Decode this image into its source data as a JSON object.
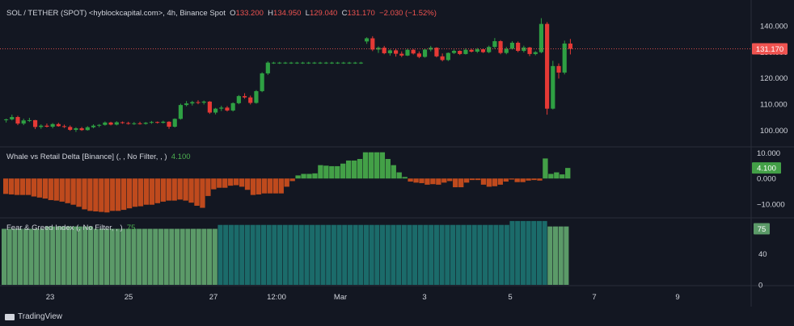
{
  "header": {
    "symbol": "SOL / TETHER (SPOT) <hyblockcapital.com>, 4h, Binance Spot",
    "o_label": "O",
    "o_value": "133.200",
    "h_label": "H",
    "h_value": "134.950",
    "l_label": "L",
    "l_value": "129.040",
    "c_label": "C",
    "c_value": "131.170",
    "change": "−2.030 (−1.52%)"
  },
  "indicators": {
    "delta_label": "Whale vs Retail Delta [Binance] (, , No Filter, , )",
    "delta_value": "4.100",
    "fg_label": "Fear & Greed Index (, No Filter, , )",
    "fg_value": "75"
  },
  "price_badge": "131.170",
  "delta_badge": "4.100",
  "fg_badge": "75",
  "footer": {
    "brand": "TradingView"
  },
  "colors": {
    "up": "#26a69a",
    "down": "#ef5350",
    "delta_pos": "#43a047",
    "delta_neg": "#bf4a1d",
    "fg_greed": "#1b6b6a",
    "fg_light": "#5b9a68"
  },
  "chart_data": [
    {
      "type": "candlestick",
      "title": "SOL / TETHER (SPOT), 4h",
      "ylim": [
        94,
        148
      ],
      "y_ticks": [
        "140.000",
        "130.000",
        "120.000",
        "110.000",
        "100.000"
      ],
      "x_ticks": [
        "23",
        "25",
        "27",
        "12:00",
        "Mar",
        "3",
        "5",
        "7",
        "9"
      ],
      "candles": [
        [
          104,
          104.5,
          103,
          104.2
        ],
        [
          104.2,
          106,
          103.8,
          105.1
        ],
        [
          105.1,
          105.6,
          102,
          102.6
        ],
        [
          102.6,
          104.5,
          102,
          103.8
        ],
        [
          103.8,
          104.8,
          103.2,
          103.9
        ],
        [
          103.9,
          104,
          100.5,
          101.3
        ],
        [
          101.3,
          102.3,
          100.6,
          101.8
        ],
        [
          101.8,
          102.6,
          101.1,
          101.4
        ],
        [
          101.4,
          102.8,
          100.8,
          102.4
        ],
        [
          102.4,
          102.9,
          101.4,
          101.6
        ],
        [
          101.6,
          102.2,
          100.9,
          101.3
        ],
        [
          101.3,
          101.9,
          99.8,
          100.2
        ],
        [
          100.2,
          101.2,
          99.4,
          100.8
        ],
        [
          100.8,
          101.3,
          99.8,
          100.1
        ],
        [
          100.1,
          101.6,
          99.9,
          101.2
        ],
        [
          101.2,
          102.3,
          100.8,
          101.8
        ],
        [
          101.8,
          102.4,
          101.2,
          102.1
        ],
        [
          102.1,
          103.4,
          101.8,
          103
        ],
        [
          103,
          103.3,
          101.9,
          102.2
        ],
        [
          102.2,
          103.5,
          101.9,
          103.1
        ],
        [
          103.1,
          103.4,
          102.5,
          102.8
        ],
        [
          102.8,
          103.3,
          102.2,
          102.6
        ],
        [
          102.6,
          103.2,
          102.1,
          102.7
        ],
        [
          102.7,
          103.3,
          102.2,
          102.5
        ],
        [
          102.5,
          103.2,
          102.2,
          102.9
        ],
        [
          102.9,
          103.6,
          102.5,
          103.2
        ],
        [
          103.2,
          103.4,
          102.6,
          102.9
        ],
        [
          102.9,
          103.7,
          102.6,
          103.3
        ],
        [
          103.3,
          103.5,
          100.6,
          101.4
        ],
        [
          101.4,
          104.6,
          101.1,
          104.4
        ],
        [
          104.4,
          110.2,
          104.1,
          109.7
        ],
        [
          109.7,
          111.2,
          109.2,
          110.3
        ],
        [
          110.3,
          111.3,
          109.5,
          110.8
        ],
        [
          110.8,
          111.5,
          110,
          110.6
        ],
        [
          110.6,
          111.4,
          109.9,
          111
        ],
        [
          111,
          111.2,
          106.3,
          106.8
        ],
        [
          106.8,
          108.6,
          106.1,
          108.3
        ],
        [
          108.3,
          109.4,
          107.4,
          108.7
        ],
        [
          108.7,
          109.3,
          107.2,
          107.6
        ],
        [
          107.6,
          110.7,
          107.2,
          110.4
        ],
        [
          110.4,
          113.5,
          110,
          113.1
        ],
        [
          113.1,
          114.2,
          112.1,
          112.6
        ],
        [
          112.6,
          113.3,
          109.9,
          110.5
        ],
        [
          110.5,
          115.4,
          110.2,
          115
        ],
        [
          115,
          122.2,
          114.6,
          121.8
        ],
        [
          121.8,
          126.4,
          121.2,
          125.9
        ],
        [
          125.9,
          126.2,
          125.4,
          125.9
        ],
        [
          125.9,
          126.2,
          125.4,
          125.9
        ],
        [
          125.9,
          126.2,
          125.4,
          125.9
        ],
        [
          125.9,
          126.2,
          125.4,
          125.9
        ],
        [
          125.9,
          126.2,
          125.4,
          125.9
        ],
        [
          125.9,
          126.2,
          125.4,
          125.9
        ],
        [
          125.9,
          126.2,
          125.4,
          125.9
        ],
        [
          125.9,
          126.2,
          125.4,
          125.9
        ],
        [
          125.9,
          126.2,
          125.4,
          125.9
        ],
        [
          125.9,
          126.2,
          125.4,
          125.9
        ],
        [
          125.9,
          126.2,
          125.4,
          125.9
        ],
        [
          125.9,
          126.2,
          125.4,
          125.9
        ],
        [
          125.9,
          126.2,
          125.4,
          125.9
        ],
        [
          125.9,
          126.2,
          125.4,
          125.9
        ],
        [
          125.9,
          126.2,
          125.4,
          125.9
        ],
        [
          125.9,
          126.2,
          125.4,
          125.9
        ],
        [
          134,
          135.6,
          133.1,
          135.2
        ],
        [
          135.2,
          136,
          130.3,
          130.9
        ],
        [
          130.9,
          132.1,
          129.6,
          131.6
        ],
        [
          131.6,
          132.3,
          129.1,
          129.5
        ],
        [
          129.5,
          131,
          128.6,
          130.6
        ],
        [
          130.6,
          131.2,
          128.2,
          129.3
        ],
        [
          129.3,
          130.2,
          128,
          128.6
        ],
        [
          128.6,
          131.2,
          128.4,
          130.8
        ],
        [
          130.8,
          131.1,
          129,
          129.4
        ],
        [
          129.4,
          130.2,
          127.6,
          128.1
        ],
        [
          128.1,
          131.3,
          127.8,
          130.9
        ],
        [
          130.9,
          132.3,
          130.2,
          131.6
        ],
        [
          131.6,
          131.8,
          127.9,
          128.3
        ],
        [
          128.3,
          129.4,
          126.4,
          126.9
        ],
        [
          126.9,
          129.8,
          126.5,
          129.6
        ],
        [
          129.6,
          130.9,
          129.2,
          130.4
        ],
        [
          130.4,
          130.6,
          128.8,
          129.2
        ],
        [
          129.2,
          131.4,
          129,
          130.8
        ],
        [
          130.8,
          131.2,
          129.8,
          130.1
        ],
        [
          130.1,
          131.5,
          129.6,
          131
        ],
        [
          131,
          131.3,
          129.6,
          129.9
        ],
        [
          129.9,
          132.4,
          129.5,
          131.9
        ],
        [
          131.9,
          135.3,
          131.2,
          134.1
        ],
        [
          134.1,
          134.5,
          129.1,
          129.6
        ],
        [
          129.6,
          131.9,
          129.1,
          131.2
        ],
        [
          131.2,
          134.1,
          130.9,
          133.5
        ],
        [
          133.5,
          134,
          129.9,
          130.4
        ],
        [
          130.4,
          132.4,
          129.8,
          131.7
        ],
        [
          131.7,
          131.9,
          128.4,
          129.2
        ],
        [
          129.2,
          130.3,
          128.7,
          129.9
        ],
        [
          129.9,
          142.9,
          129.5,
          140.7
        ],
        [
          140.7,
          141.4,
          106,
          108.3
        ],
        [
          108.3,
          126.6,
          108,
          124.6
        ],
        [
          124.6,
          125.6,
          119.8,
          122.1
        ],
        [
          122.1,
          134.3,
          121.4,
          133.2
        ],
        [
          133.2,
          134.95,
          129.04,
          131.17
        ]
      ],
      "last_price": 131.17,
      "last_label": "131.170"
    },
    {
      "type": "bar",
      "title": "Whale vs Retail Delta [Binance]",
      "ylim": [
        -15,
        12
      ],
      "y_ticks": [
        "10.000",
        "0.000",
        "−10.000"
      ],
      "values": [
        -6,
        -6.2,
        -6.4,
        -6.4,
        -6.4,
        -7,
        -7.4,
        -7.8,
        -8.4,
        -8.6,
        -9,
        -9.6,
        -10.2,
        -11,
        -12,
        -12.6,
        -12.8,
        -13,
        -13.2,
        -12.6,
        -12.6,
        -12.2,
        -11.6,
        -11,
        -10.8,
        -10.2,
        -10.2,
        -9.6,
        -9,
        -8.6,
        -8.6,
        -8.2,
        -8.6,
        -9.4,
        -10.6,
        -11.4,
        -6.8,
        -4.2,
        -3.6,
        -3.6,
        -2.8,
        -2.6,
        -3.2,
        -4.4,
        -6.4,
        -6.2,
        -5.8,
        -5.8,
        -5.8,
        -5.8,
        -3.2,
        -1,
        1.2,
        1.8,
        1.8,
        2,
        5.2,
        5,
        4.8,
        4.8,
        5.8,
        7,
        7,
        7.6,
        10.2,
        10.2,
        10.2,
        10.2,
        7.6,
        5.2,
        2.4,
        0.6,
        -1.2,
        -1.6,
        -1.8,
        -2.4,
        -2.2,
        -2.4,
        -1.6,
        -1,
        -3.4,
        -3.4,
        -1.6,
        -0.6,
        -0.6,
        -2.4,
        -3.2,
        -3,
        -2.4,
        -1.2,
        -0.4,
        -1.4,
        -1.4,
        -0.8,
        -0.6,
        -0.8,
        7.8,
        1.8,
        2.4,
        1.6,
        4.1
      ],
      "last_label": "4.100"
    },
    {
      "type": "bar",
      "title": "Fear & Greed Index",
      "ylim": [
        0,
        85
      ],
      "y_ticks": [
        "75",
        "40",
        "0"
      ],
      "values": [
        72,
        72,
        72,
        72,
        72,
        72,
        72,
        72,
        75,
        75,
        75,
        75,
        75,
        75,
        75,
        75,
        75,
        72,
        72,
        72,
        72,
        72,
        72,
        72,
        72,
        72,
        72,
        72,
        72,
        72,
        72,
        72,
        72,
        72,
        72,
        72,
        72,
        72,
        72,
        72,
        77,
        77,
        77,
        77,
        77,
        77,
        77,
        77,
        77,
        77,
        77,
        77,
        77,
        77,
        77,
        77,
        77,
        77,
        77,
        77,
        77,
        77,
        77,
        77,
        77,
        77,
        77,
        77,
        77,
        77,
        77,
        77,
        77,
        77,
        77,
        77,
        77,
        77,
        77,
        77,
        77,
        77,
        77,
        77,
        77,
        77,
        77,
        77,
        77,
        77,
        77,
        77,
        77,
        77,
        82,
        82,
        82,
        82,
        82,
        82,
        82,
        75,
        75,
        75,
        75
      ],
      "last_label": "75"
    }
  ]
}
